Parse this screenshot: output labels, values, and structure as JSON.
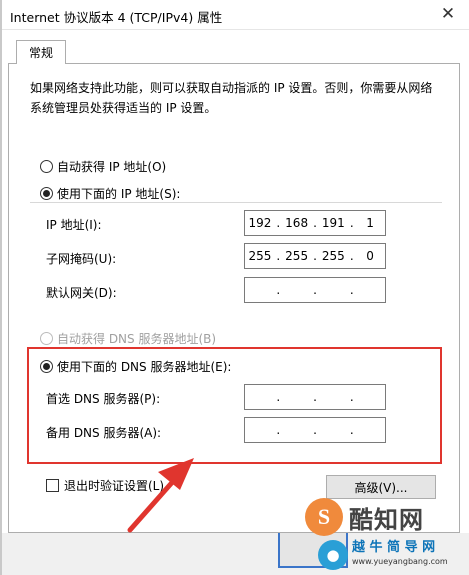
{
  "window": {
    "title": "Internet 协议版本 4 (TCP/IPv4) 属性",
    "close_glyph": "✕"
  },
  "tabs": [
    {
      "label": "常规",
      "selected": true
    }
  ],
  "description": "如果网络支持此功能，则可以获取自动指派的 IP 设置。否则，你需要从网络系统管理员处获得适当的 IP 设置。",
  "ip_section": {
    "auto_label": "自动获得 IP 地址(O)",
    "auto_checked": false,
    "manual_label": "使用下面的 IP 地址(S):",
    "manual_checked": true,
    "fields": [
      {
        "label": "IP 地址(I):",
        "octets": [
          "192",
          "168",
          "191",
          "1"
        ]
      },
      {
        "label": "子网掩码(U):",
        "octets": [
          "255",
          "255",
          "255",
          "0"
        ]
      },
      {
        "label": "默认网关(D):",
        "octets": [
          "",
          "",
          "",
          ""
        ]
      }
    ]
  },
  "dns_section": {
    "auto_label": "自动获得 DNS 服务器地址(B)",
    "auto_disabled": true,
    "manual_label": "使用下面的 DNS 服务器地址(E):",
    "manual_checked": true,
    "fields": [
      {
        "label": "首选 DNS 服务器(P):",
        "octets": [
          "",
          "",
          "",
          ""
        ]
      },
      {
        "label": "备用 DNS 服务器(A):",
        "octets": [
          "",
          "",
          "",
          ""
        ]
      }
    ]
  },
  "validate": {
    "label": "退出时验证设置(L)",
    "checked": false
  },
  "advanced_button": {
    "label": "高级(V)..."
  },
  "watermarks": {
    "logo1_glyph": "S",
    "logo1_text": "酷知网",
    "logo2_cn": "越 牛 简 导 网",
    "logo2_url": "www.yueyangbang.com"
  },
  "colors": {
    "highlight_box": "#e0352e",
    "arrow": "#e0352e",
    "ok_button_border": "#3b75c9"
  }
}
